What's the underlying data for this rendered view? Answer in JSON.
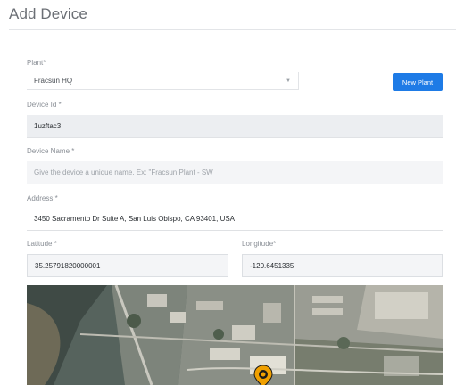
{
  "page": {
    "title": "Add Device"
  },
  "plant": {
    "label": "Plant*",
    "value": "Fracsun HQ"
  },
  "new_plant_button": {
    "label": "New Plant"
  },
  "device_id": {
    "label": "Device Id *",
    "value": "1uzftac3"
  },
  "device_name": {
    "label": "Device Name *",
    "placeholder": "Give the device a unique name. Ex: \"Fracsun Plant - SW"
  },
  "address": {
    "label": "Address *",
    "value": "3450 Sacramento Dr Suite A, San Luis Obispo, CA 93401, USA"
  },
  "latitude": {
    "label": "Latitude *",
    "value": "35.25791820000001"
  },
  "longitude": {
    "label": "Longitude*",
    "value": "-120.6451335"
  },
  "colors": {
    "primary": "#1e7be6",
    "pin": "#f0a000"
  },
  "icons": {
    "select_caret": "caret-down-icon",
    "map_marker": "map-pin-icon"
  }
}
